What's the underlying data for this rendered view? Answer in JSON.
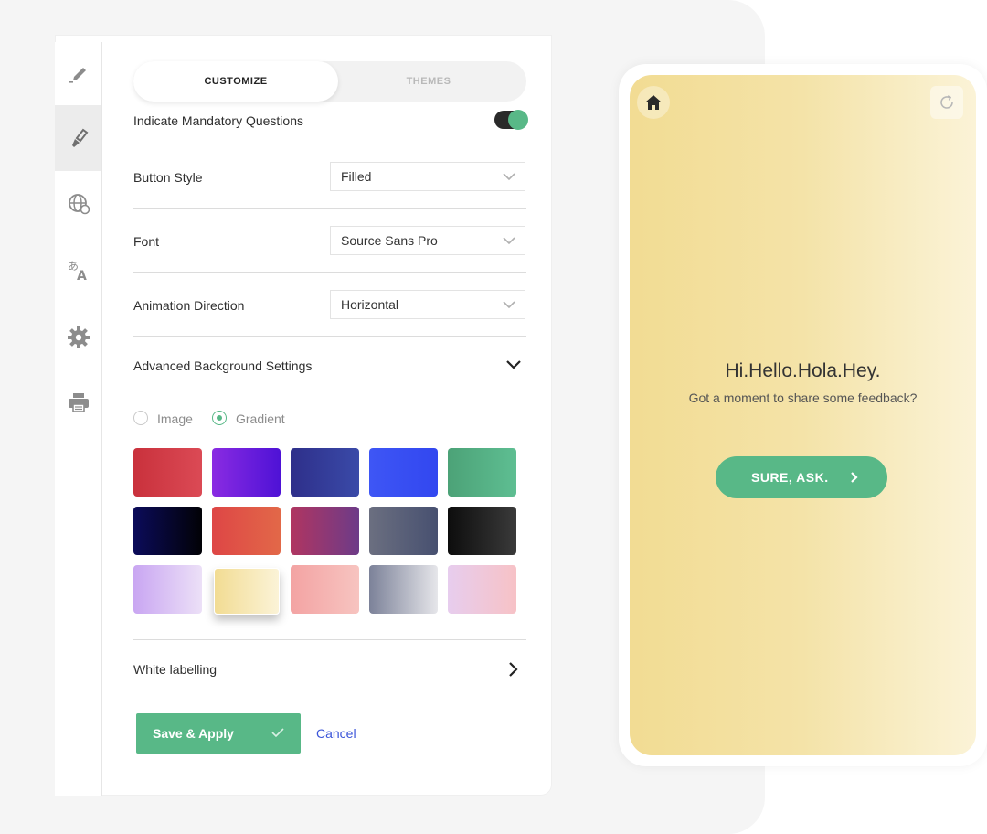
{
  "tabs": {
    "customize": "CUSTOMIZE",
    "themes": "THEMES"
  },
  "sidebar": {
    "items": [
      {
        "icon": "pencil-icon"
      },
      {
        "icon": "paint-brush-icon",
        "active": true
      },
      {
        "icon": "globe-icon"
      },
      {
        "icon": "translate-icon"
      },
      {
        "icon": "gear-icon"
      },
      {
        "icon": "printer-icon"
      }
    ]
  },
  "settings": {
    "mandatory_label": "Indicate Mandatory Questions",
    "mandatory_on": true,
    "button_style_label": "Button Style",
    "button_style_value": "Filled",
    "font_label": "Font",
    "font_value": "Source Sans Pro",
    "animation_label": "Animation Direction",
    "animation_value": "Horizontal",
    "advanced_label": "Advanced Background Settings",
    "bg_options": {
      "image": "Image",
      "gradient": "Gradient",
      "selected": "Gradient"
    },
    "white_labelling": "White labelling"
  },
  "gradients": [
    {
      "from": "#c9313c",
      "to": "#db4a55"
    },
    {
      "from": "#8a2be2",
      "to": "#4e12d6"
    },
    {
      "from": "#2e2f8a",
      "to": "#3a4aa8"
    },
    {
      "from": "#3e56f5",
      "to": "#3247f0"
    },
    {
      "from": "#4ca277",
      "to": "#5ebe92"
    },
    {
      "from": "#0b0b5a",
      "to": "#020206"
    },
    {
      "from": "#de4646",
      "to": "#e26848"
    },
    {
      "from": "#b03561",
      "to": "#6d3b88"
    },
    {
      "from": "#6b6f80",
      "to": "#475070"
    },
    {
      "from": "#0d0d0d",
      "to": "#3a3a3a"
    },
    {
      "from": "#c9a6f2",
      "to": "#ece0f7"
    },
    {
      "from": "#f2dc93",
      "to": "#fbf3d7",
      "selected": true
    },
    {
      "from": "#f3a3a3",
      "to": "#f7c4c0"
    },
    {
      "from": "#7c8299",
      "to": "#e6e6ea"
    },
    {
      "from": "#e7cdee",
      "to": "#f7c2c6"
    }
  ],
  "actions": {
    "save": "Save & Apply",
    "cancel": "Cancel"
  },
  "colors": {
    "accent": "#58b887",
    "link": "#3b55d9"
  },
  "preview": {
    "greeting": "Hi.Hello.Hola.Hey.",
    "subtitle": "Got a moment to share some feedback?",
    "cta": "SURE, ASK."
  }
}
